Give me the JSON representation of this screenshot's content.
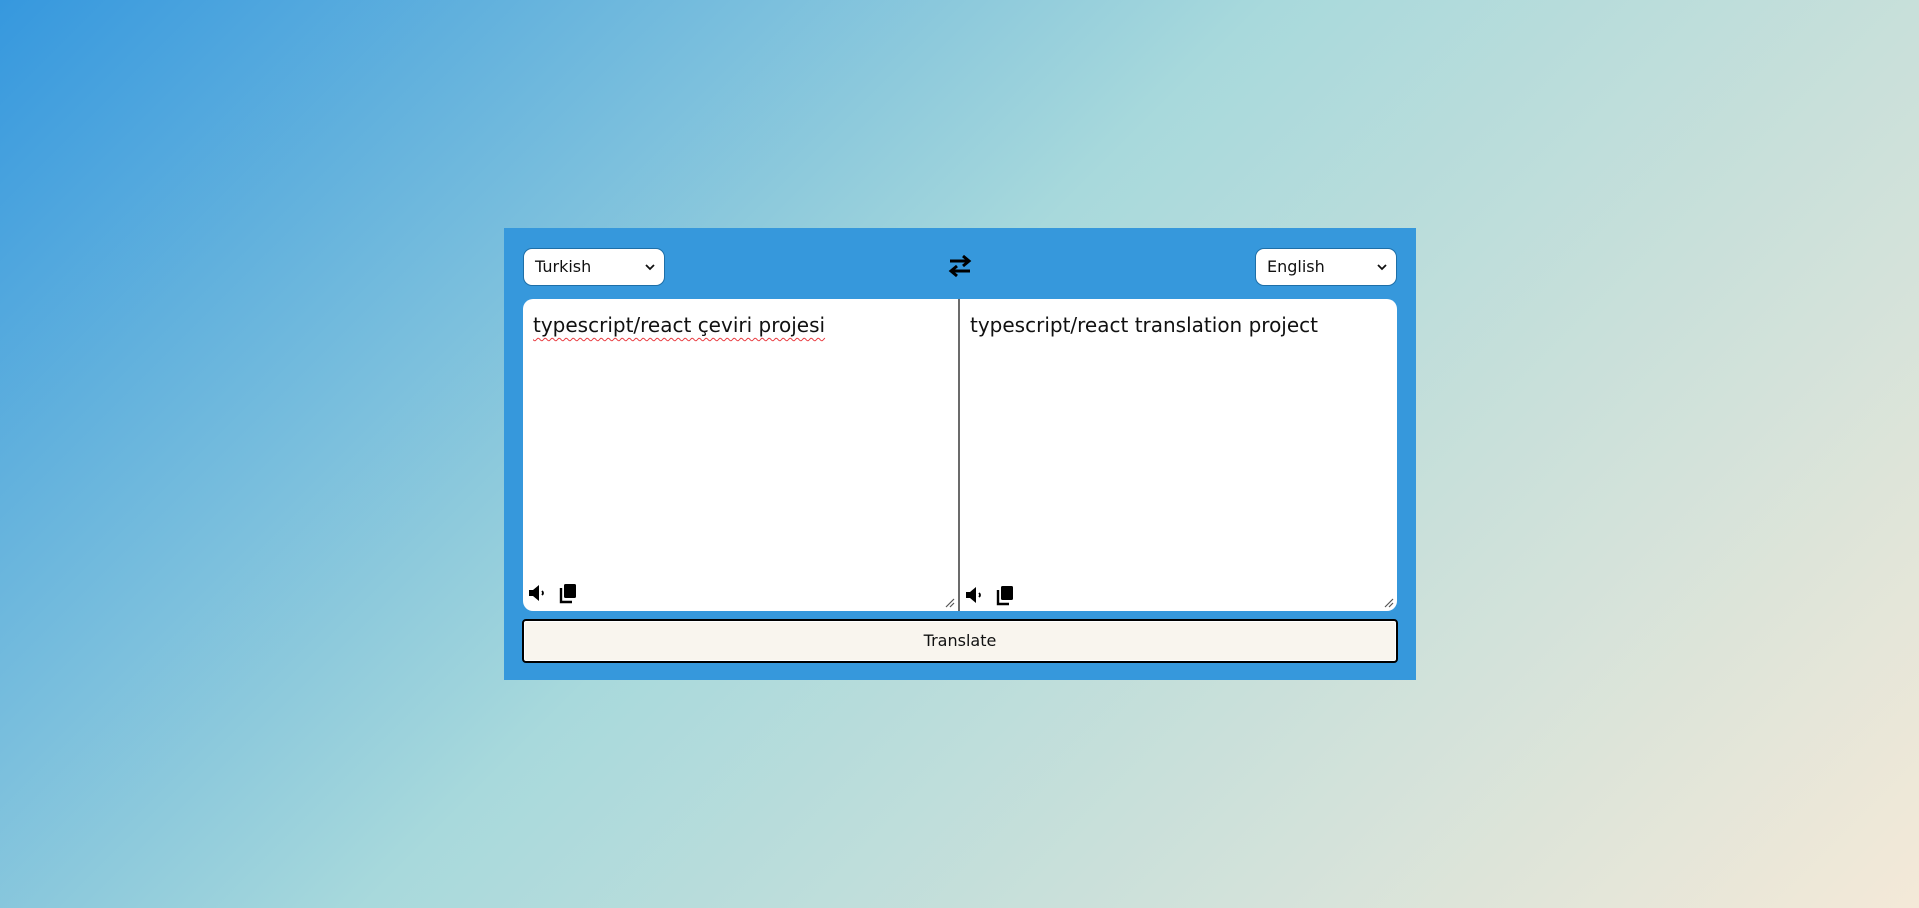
{
  "source_language": {
    "selected": "Turkish",
    "icon": "chevron-down-icon"
  },
  "target_language": {
    "selected": "English",
    "icon": "chevron-down-icon"
  },
  "swap": {
    "icon": "swap-arrows-icon"
  },
  "source_pane": {
    "text": "typescript/react çeviri projesi",
    "icons": [
      "speaker-icon",
      "copy-icon"
    ]
  },
  "target_pane": {
    "text": "typescript/react translation project",
    "icons": [
      "speaker-icon",
      "copy-icon"
    ]
  },
  "translate_button": {
    "label": "Translate"
  },
  "colors": {
    "panel": "#3698dc",
    "button_bg": "#f9f5ee",
    "spellcheck": "#e8393e"
  }
}
